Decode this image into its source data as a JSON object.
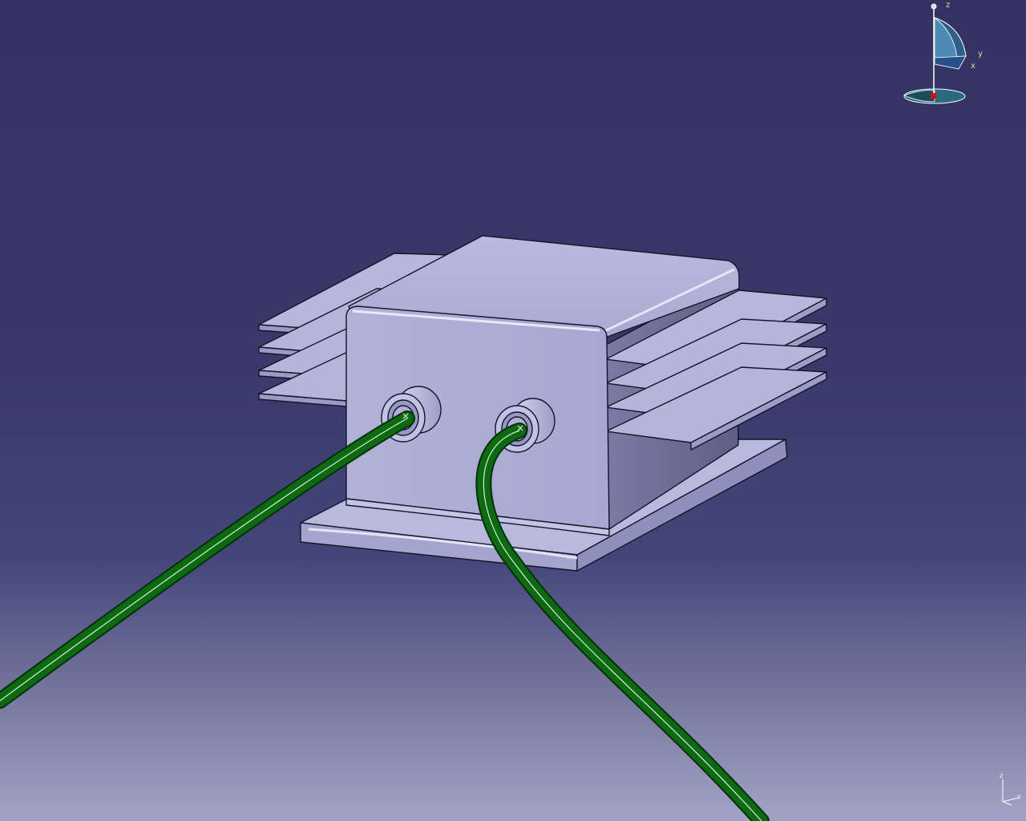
{
  "viewer": {
    "background_top": "#343262",
    "background_bottom": "#a3a3c6",
    "part_color": "#b3b3d8",
    "part_shadow": "#6e6f94",
    "cable_color": "#0d6a12"
  },
  "compass": {
    "icon": "compass-icon",
    "z_label": "z",
    "y_label": "y",
    "x_label": "x"
  },
  "axis_triad": {
    "icon": "axis-triad-icon",
    "z_label": "z",
    "y_label": "y"
  }
}
